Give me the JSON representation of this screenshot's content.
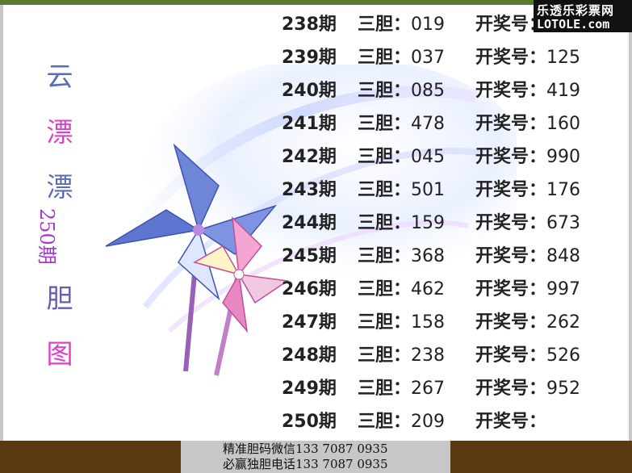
{
  "brand": {
    "cn": "乐透乐彩票网",
    "en": "LOTOLE.com"
  },
  "side_title": [
    "云",
    "漂",
    "漂",
    "胆",
    "图"
  ],
  "issue_label": "250期",
  "dan_label": "三胆：",
  "kai_label": "开奖号：",
  "rows": [
    {
      "period": "238期",
      "dan": "019",
      "kai": ""
    },
    {
      "period": "239期",
      "dan": "037",
      "kai": "125"
    },
    {
      "period": "240期",
      "dan": "085",
      "kai": "419"
    },
    {
      "period": "241期",
      "dan": "478",
      "kai": "160"
    },
    {
      "period": "242期",
      "dan": "045",
      "kai": "990"
    },
    {
      "period": "243期",
      "dan": "501",
      "kai": "176"
    },
    {
      "period": "244期",
      "dan": "159",
      "kai": "673"
    },
    {
      "period": "245期",
      "dan": "368",
      "kai": "848"
    },
    {
      "period": "246期",
      "dan": "462",
      "kai": "997"
    },
    {
      "period": "247期",
      "dan": "158",
      "kai": "262"
    },
    {
      "period": "248期",
      "dan": "238",
      "kai": "526"
    },
    {
      "period": "249期",
      "dan": "267",
      "kai": "952"
    },
    {
      "period": "250期",
      "dan": "209",
      "kai": ""
    }
  ],
  "contact": [
    "精准胆码微信133  7087  0935",
    "必赢独胆电话133  7087  0935"
  ],
  "colors": {
    "frame_top": "#5a7a2c",
    "bottom_bar": "#5b3a12",
    "contact_bg": "#c7c7c7"
  }
}
